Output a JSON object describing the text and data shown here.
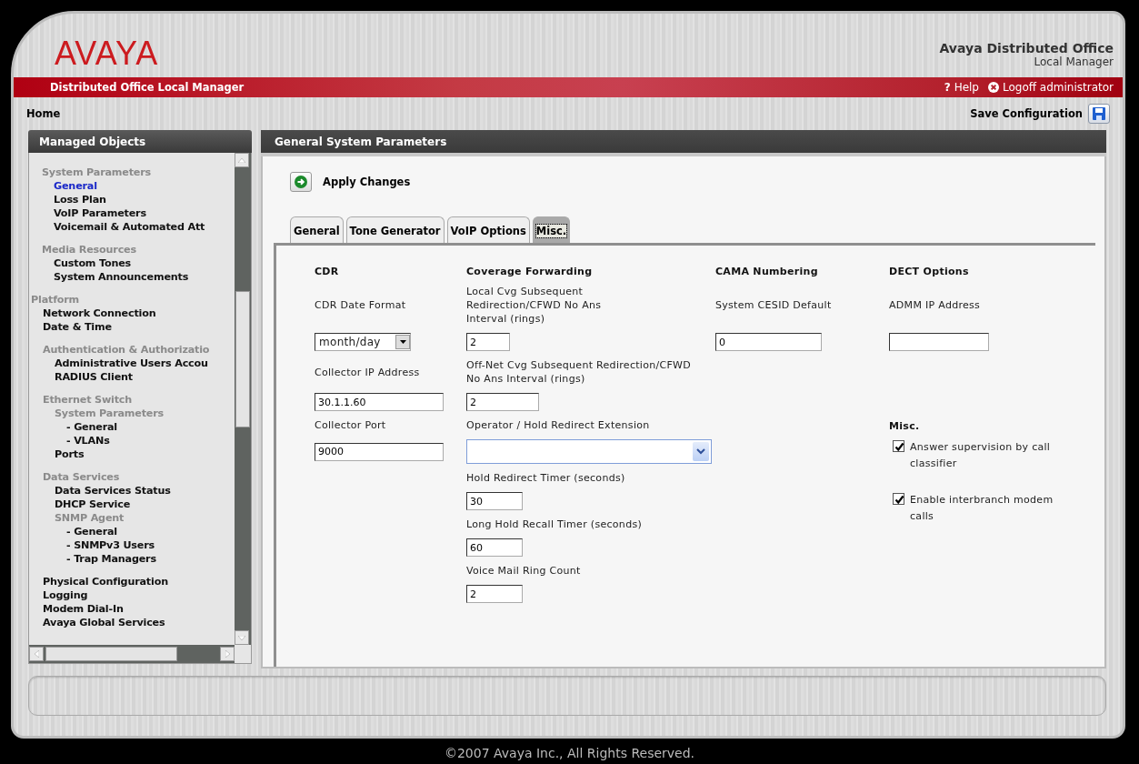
{
  "header": {
    "logo": "AVAYA",
    "product_title": "Avaya Distributed Office",
    "product_subtitle": "Local Manager"
  },
  "banner": {
    "title": "Distributed Office Local Manager",
    "help": {
      "icon": "?",
      "label": "Help"
    },
    "logoff": "Logoff administrator"
  },
  "breadcrumb": "Home",
  "save_configuration": "Save Configuration",
  "sidebar": {
    "title": "Managed Objects",
    "items": [
      {
        "label": "System Parameters",
        "kind": "group",
        "selected": false,
        "children": [
          {
            "label": "General",
            "kind": "link",
            "selected": true
          },
          {
            "label": "Loss Plan",
            "kind": "link",
            "selected": false
          },
          {
            "label": "VoIP Parameters",
            "kind": "link",
            "selected": false
          },
          {
            "label": "Voicemail & Automated Att",
            "kind": "link",
            "selected": false
          }
        ]
      },
      {
        "label": "Media Resources",
        "kind": "group",
        "selected": false,
        "children": [
          {
            "label": "Custom Tones",
            "kind": "link",
            "selected": false
          },
          {
            "label": "System Announcements",
            "kind": "link",
            "selected": false
          }
        ]
      },
      {
        "label": "Platform",
        "kind": "section",
        "selected": false,
        "children": [
          {
            "label": "Network Connection",
            "kind": "link",
            "selected": false
          },
          {
            "label": "Date & Time",
            "kind": "link",
            "selected": false
          },
          {
            "label": "Authentication & Authorizatio",
            "kind": "group",
            "selected": false,
            "children": [
              {
                "label": "Administrative Users Accou",
                "kind": "link",
                "selected": false
              },
              {
                "label": "RADIUS Client",
                "kind": "link",
                "selected": false
              }
            ]
          },
          {
            "label": "Ethernet Switch",
            "kind": "group",
            "selected": false,
            "children": [
              {
                "label": "System Parameters",
                "kind": "group",
                "selected": false,
                "children": [
                  {
                    "label": "- General",
                    "kind": "link",
                    "selected": false
                  },
                  {
                    "label": "- VLANs",
                    "kind": "link",
                    "selected": false
                  }
                ]
              },
              {
                "label": "Ports",
                "kind": "link",
                "selected": false
              }
            ]
          },
          {
            "label": "Data Services",
            "kind": "group",
            "selected": false,
            "children": [
              {
                "label": "Data Services Status",
                "kind": "link",
                "selected": false
              },
              {
                "label": "DHCP Service",
                "kind": "link",
                "selected": false
              },
              {
                "label": "SNMP Agent",
                "kind": "group",
                "selected": false,
                "children": [
                  {
                    "label": "- General",
                    "kind": "link",
                    "selected": false
                  },
                  {
                    "label": "- SNMPv3 Users",
                    "kind": "link",
                    "selected": false
                  },
                  {
                    "label": "- Trap Managers",
                    "kind": "link",
                    "selected": false
                  }
                ]
              }
            ]
          },
          {
            "label": "Physical Configuration",
            "kind": "link",
            "selected": false
          },
          {
            "label": "Logging",
            "kind": "link",
            "selected": false
          },
          {
            "label": "Modem Dial-In",
            "kind": "link",
            "selected": false
          },
          {
            "label": "Avaya Global Services",
            "kind": "link",
            "selected": false
          }
        ]
      }
    ]
  },
  "main": {
    "title": "General System Parameters",
    "apply": "Apply Changes",
    "tabs": [
      {
        "label": "General",
        "selected": false
      },
      {
        "label": "Tone Generator",
        "selected": false
      },
      {
        "label": "VoIP Options",
        "selected": false
      },
      {
        "label": "Misc.",
        "selected": true
      }
    ],
    "columns": [
      {
        "heading": "CDR",
        "fields": [
          {
            "label": "CDR Date Format",
            "kind": "dropdown",
            "value": "month/day"
          },
          {
            "label": "Collector IP Address",
            "kind": "text",
            "value": "30.1.1.60"
          },
          {
            "label": "Collector Port",
            "kind": "text",
            "value": "9000"
          }
        ]
      },
      {
        "heading": "Coverage Forwarding",
        "fields": [
          {
            "label": "Local Cvg Subsequent Redirection/CFWD No Ans Interval (rings)",
            "kind": "text",
            "value": "2"
          },
          {
            "label": "Off-Net Cvg Subsequent Redirection/CFWD No Ans Interval (rings)",
            "kind": "text",
            "value": "2"
          },
          {
            "label": "Operator / Hold Redirect Extension",
            "kind": "combo"
          },
          {
            "label": "Hold Redirect Timer (seconds)",
            "kind": "text",
            "value": "30"
          },
          {
            "label": "Long Hold Recall Timer (seconds)",
            "kind": "text",
            "value": "60"
          },
          {
            "label": "Voice Mail Ring Count",
            "kind": "text",
            "value": "2"
          }
        ]
      },
      {
        "heading": "CAMA Numbering",
        "fields": [
          {
            "label": "System CESID Default",
            "kind": "text",
            "value": "0"
          }
        ]
      },
      {
        "heading": "DECT Options",
        "fields": [
          {
            "label": "ADMM IP Address",
            "kind": "text"
          }
        ]
      }
    ],
    "misc": {
      "heading": "Misc.",
      "checkboxes": [
        {
          "label": "Answer supervision by call classifier",
          "checked": true
        },
        {
          "label": "Enable interbranch modem calls",
          "checked": true
        }
      ]
    }
  },
  "footer": {
    "copyright": "©2007 Avaya Inc., All Rights Reserved."
  }
}
